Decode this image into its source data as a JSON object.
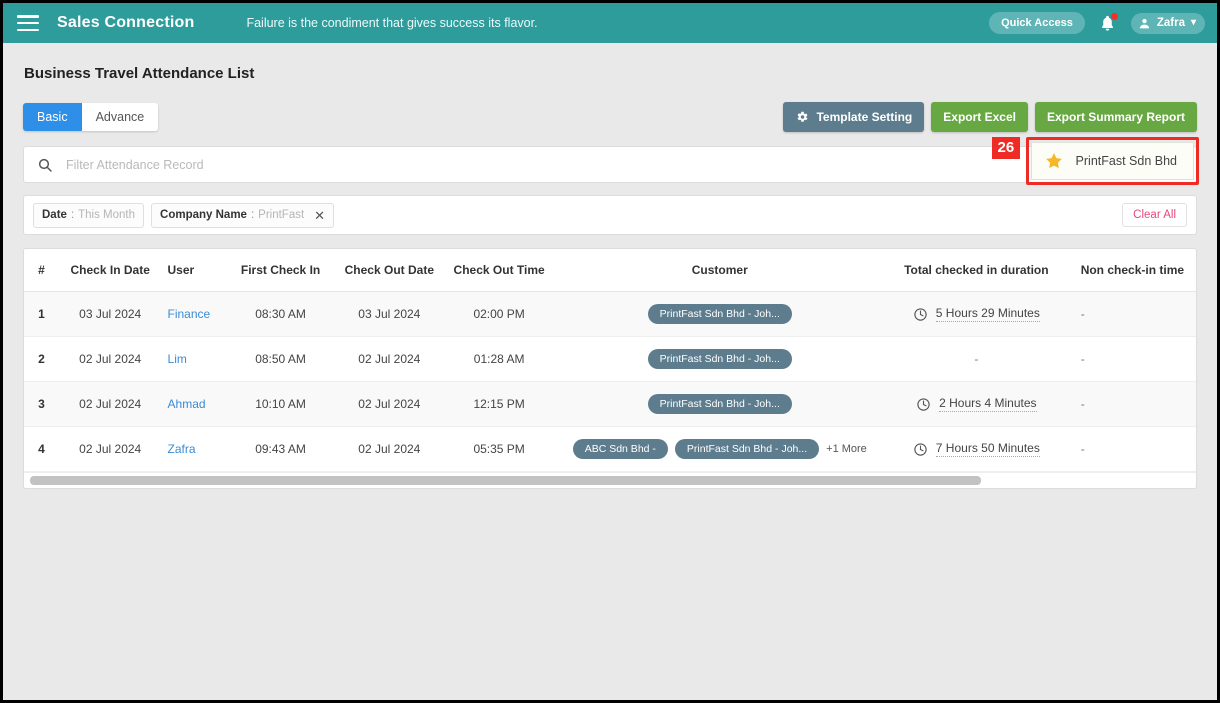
{
  "topbar": {
    "menu_icon": "hamburger-icon",
    "brand": "Sales Connection",
    "quote": "Failure is the condiment that gives success its flavor.",
    "quick_access": "Quick Access",
    "bell_icon": "bell-icon",
    "user_name": "Zafra",
    "chevron": "⌄",
    "accent_color": "#2f9c9c"
  },
  "page": {
    "title": "Business Travel Attendance List"
  },
  "tabs": [
    {
      "label": "Basic",
      "active": true
    },
    {
      "label": "Advance",
      "active": false
    }
  ],
  "actions": {
    "template_setting": "Template Setting",
    "template_icon": "gear-icon",
    "export_excel": "Export Excel",
    "export_summary": "Export Summary Report",
    "slate_color": "#5d7d8e",
    "green_color": "#67a843"
  },
  "search": {
    "icon": "search-icon",
    "placeholder": "Filter Attendance Record",
    "value": ""
  },
  "favorite": {
    "badge": "26",
    "star_icon": "star-icon",
    "label": "PrintFast Sdn Bhd",
    "highlight_color": "#ee2b24"
  },
  "filters": {
    "chips": [
      {
        "key": "Date",
        "sep": ":",
        "value": "This Month",
        "removable": false
      },
      {
        "key": "Company Name",
        "sep": ":",
        "value": "PrintFast",
        "removable": true,
        "close_icon": "close-icon"
      }
    ],
    "clear_all": "Clear All"
  },
  "table": {
    "columns": [
      "#",
      "Check In Date",
      "User",
      "First Check In",
      "Check Out Date",
      "Check Out Time",
      "Customer",
      "Total checked in duration",
      "Non check-in time"
    ],
    "rows": [
      {
        "index": "1",
        "check_in_date": "03 Jul 2024",
        "user": "Finance",
        "first_check_in": "08:30 AM",
        "check_out_date": "03 Jul 2024",
        "check_out_time": "02:00 PM",
        "customers": [
          "PrintFast Sdn Bhd - Joh..."
        ],
        "more": "",
        "duration": "5 Hours 29 Minutes",
        "non_check_in": "-"
      },
      {
        "index": "2",
        "check_in_date": "02 Jul 2024",
        "user": "Lim",
        "first_check_in": "08:50 AM",
        "check_out_date": "02 Jul 2024",
        "check_out_time": "01:28 AM",
        "customers": [
          "PrintFast Sdn Bhd - Joh..."
        ],
        "more": "",
        "duration": "-",
        "non_check_in": "-"
      },
      {
        "index": "3",
        "check_in_date": "02 Jul 2024",
        "user": "Ahmad",
        "first_check_in": "10:10 AM",
        "check_out_date": "02 Jul 2024",
        "check_out_time": "12:15 PM",
        "customers": [
          "PrintFast Sdn Bhd - Joh..."
        ],
        "more": "",
        "duration": "2 Hours 4 Minutes",
        "non_check_in": "-"
      },
      {
        "index": "4",
        "check_in_date": "02 Jul 2024",
        "user": "Zafra",
        "first_check_in": "09:43 AM",
        "check_out_date": "02 Jul 2024",
        "check_out_time": "05:35 PM",
        "customers": [
          "ABC Sdn Bhd -",
          "PrintFast Sdn Bhd - Joh..."
        ],
        "more": "+1 More",
        "duration": "7 Hours 50 Minutes",
        "non_check_in": "-"
      }
    ],
    "clock_icon": "clock-icon",
    "scrollbar": "horizontal-scrollbar"
  }
}
